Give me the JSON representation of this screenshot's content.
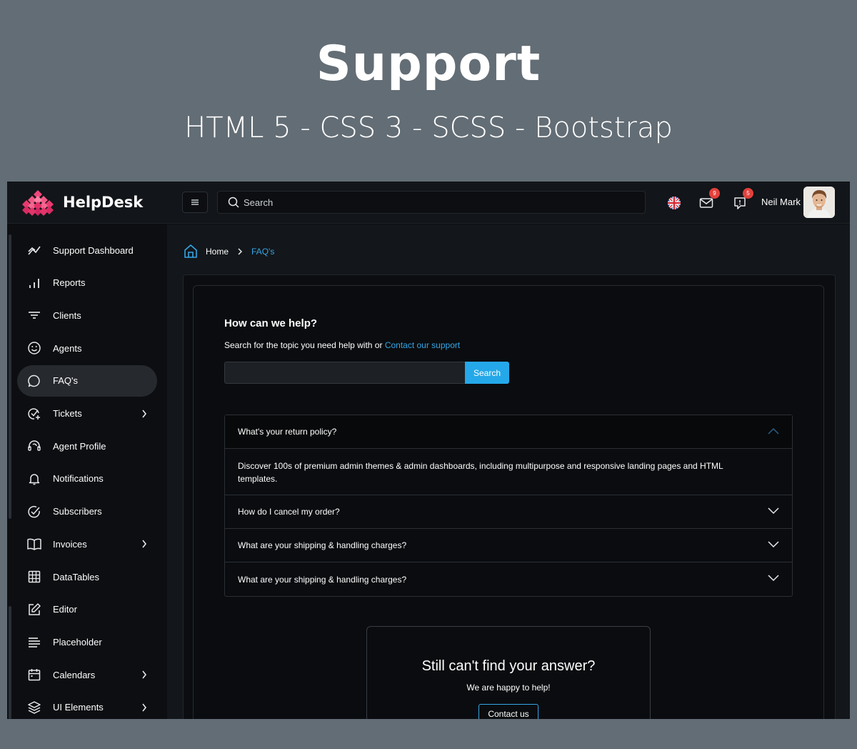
{
  "banner": {
    "title": "Support",
    "subtitle": "HTML 5 - CSS 3 - SCSS - Bootstrap"
  },
  "app": {
    "brand": "HelpDesk",
    "search_placeholder": "Search",
    "mail_badge": "9",
    "chat_badge": "5",
    "user_name": "Neil Mark"
  },
  "sidebar": {
    "items": [
      {
        "label": "Support Dashboard",
        "icon": "trend-icon",
        "active": false,
        "chevron": false
      },
      {
        "label": "Reports",
        "icon": "bar-chart-icon",
        "active": false,
        "chevron": false
      },
      {
        "label": "Clients",
        "icon": "filter-icon",
        "active": false,
        "chevron": false
      },
      {
        "label": "Agents",
        "icon": "smiley-icon",
        "active": false,
        "chevron": false
      },
      {
        "label": "FAQ's",
        "icon": "chat-bubble-icon",
        "active": true,
        "chevron": false
      },
      {
        "label": "Tickets",
        "icon": "check-plus-icon",
        "active": false,
        "chevron": true
      },
      {
        "label": "Agent Profile",
        "icon": "headset-icon",
        "active": false,
        "chevron": false
      },
      {
        "label": "Notifications",
        "icon": "bell-icon",
        "active": false,
        "chevron": false
      },
      {
        "label": "Subscribers",
        "icon": "check-circle-icon",
        "active": false,
        "chevron": false
      },
      {
        "label": "Invoices",
        "icon": "book-icon",
        "active": false,
        "chevron": true
      },
      {
        "label": "DataTables",
        "icon": "grid-icon",
        "active": false,
        "chevron": false
      },
      {
        "label": "Editor",
        "icon": "edit-icon",
        "active": false,
        "chevron": false
      },
      {
        "label": "Placeholder",
        "icon": "lines-icon",
        "active": false,
        "chevron": false
      },
      {
        "label": "Calendars",
        "icon": "calendar-icon",
        "active": false,
        "chevron": true
      },
      {
        "label": "UI Elements",
        "icon": "layers-icon",
        "active": false,
        "chevron": true
      }
    ]
  },
  "breadcrumb": {
    "home": "Home",
    "current": "FAQ's"
  },
  "help": {
    "title": "How can we help?",
    "desc": "Search for the topic you need help with or ",
    "link": "Contact our support",
    "search_value": "",
    "search_button": "Search"
  },
  "faq": [
    {
      "question": "What's your return policy?",
      "open": true,
      "answer": "Discover 100s of premium admin themes & admin dashboards, including multipurpose and responsive landing pages and HTML templates."
    },
    {
      "question": "How do I cancel my order?",
      "open": false
    },
    {
      "question": "What are your shipping & handling charges?",
      "open": false
    },
    {
      "question": "What are your shipping & handling charges?",
      "open": false
    }
  ],
  "contact": {
    "title": "Still can't find your answer?",
    "subtitle": "We are happy to help!",
    "button": "Contact us"
  },
  "colors": {
    "accent": "#35a6e5",
    "search_button": "#25a8e9",
    "badge": "#e2413c",
    "logo_pink": "#f0457a"
  }
}
